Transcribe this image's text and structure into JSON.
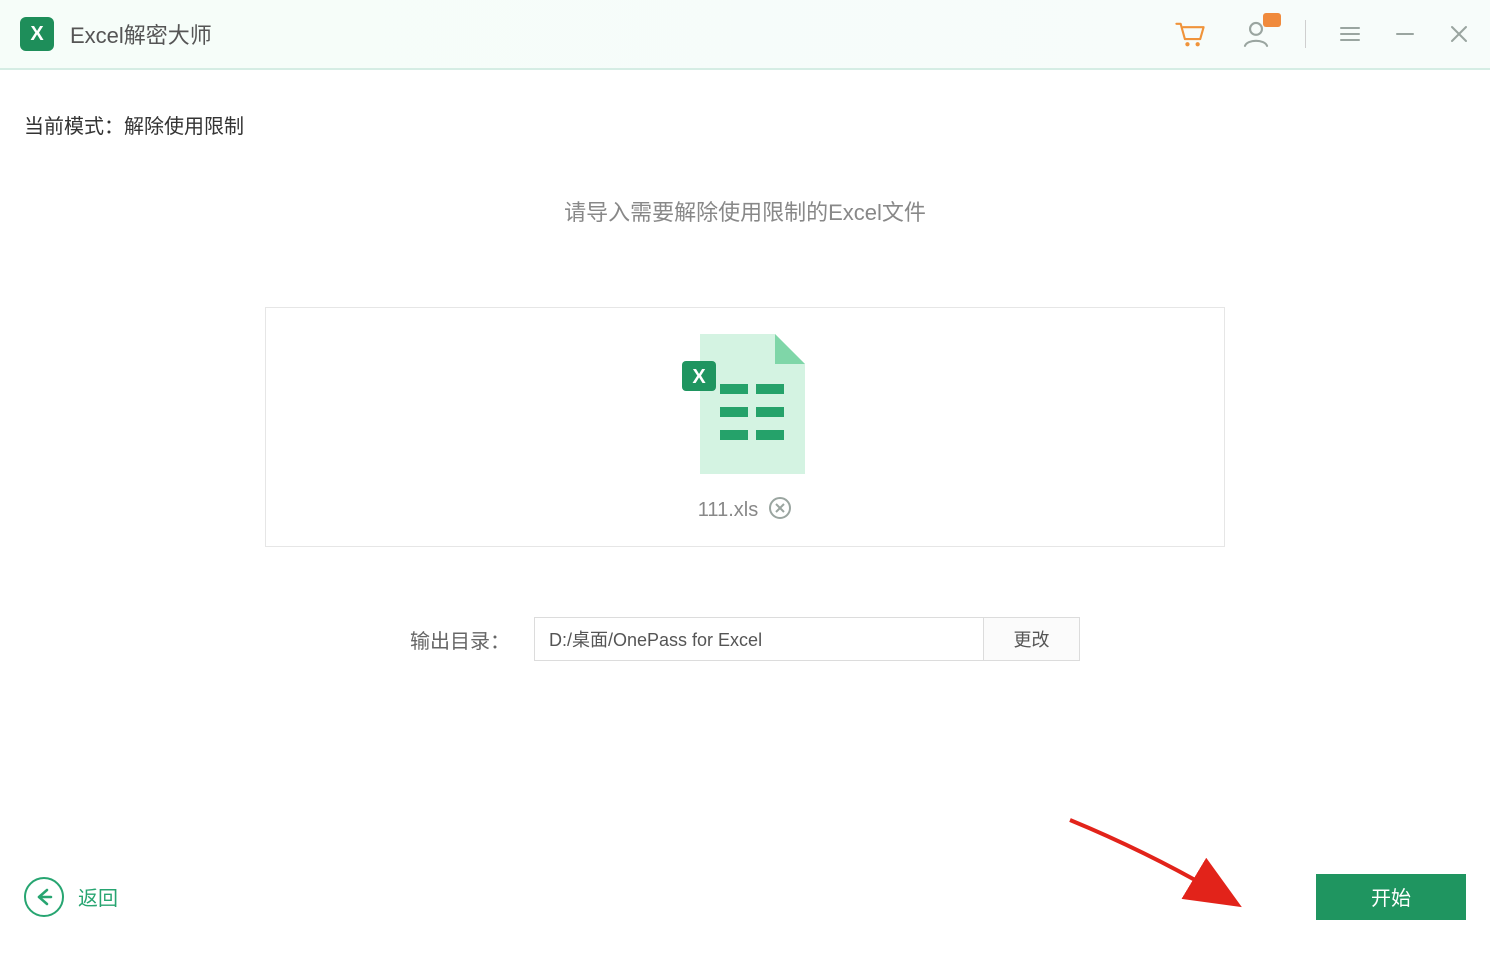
{
  "app": {
    "title": "Excel解密大师"
  },
  "mode": {
    "prefix": "当前模式：",
    "value": "解除使用限制"
  },
  "instruction": "请导入需要解除使用限制的Excel文件",
  "file": {
    "name": "111.xls"
  },
  "output": {
    "label": "输出目录：",
    "path": "D:/桌面/OnePass for Excel",
    "change_label": "更改"
  },
  "footer": {
    "back_label": "返回",
    "start_label": "开始"
  },
  "colors": {
    "accent": "#1f9560",
    "accent_light": "#27a571"
  }
}
